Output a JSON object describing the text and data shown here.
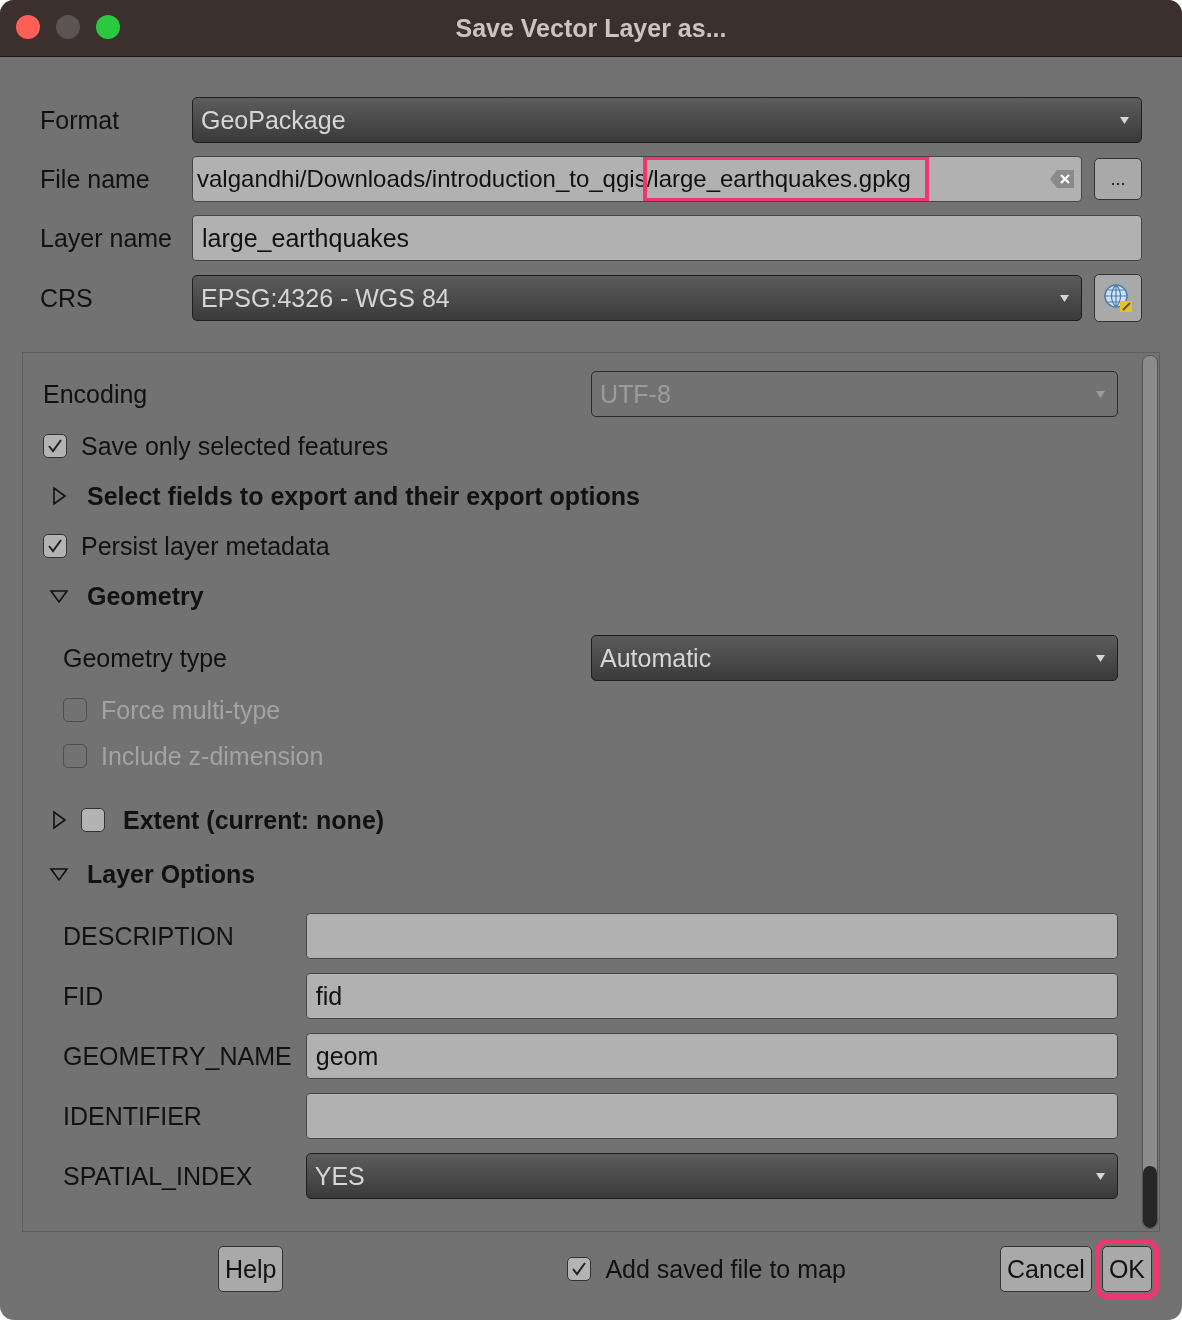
{
  "window": {
    "title": "Save Vector Layer as..."
  },
  "top_fields": [
    {
      "kind": "combo",
      "label": "Format",
      "value": "GeoPackage"
    },
    {
      "kind": "file",
      "label": "File name",
      "value": "valgandhi/Downloads/introduction_to_qgis",
      "value_highlighted": "/large_earthquakes.gpkg",
      "browse": "..."
    },
    {
      "kind": "text",
      "label": "Layer name",
      "value": "large_earthquakes"
    },
    {
      "kind": "crs",
      "label": "CRS",
      "value": "EPSG:4326 - WGS 84"
    }
  ],
  "options": [
    {
      "kind": "combo",
      "label": "Encoding",
      "value": "UTF-8",
      "disabled": true
    },
    {
      "kind": "checkbox",
      "label": "Save only selected features",
      "checked": true,
      "disabled": false
    },
    {
      "kind": "group",
      "label": "Select fields to export and their export options",
      "expanded": false
    },
    {
      "kind": "checkbox",
      "label": "Persist layer metadata",
      "checked": true,
      "disabled": false
    },
    {
      "kind": "group",
      "label": "Geometry",
      "expanded": true,
      "children": [
        {
          "kind": "combo",
          "label": "Geometry type",
          "value": "Automatic",
          "disabled": false
        },
        {
          "kind": "checkbox",
          "label": "Force multi-type",
          "checked": false,
          "disabled": true
        },
        {
          "kind": "checkbox",
          "label": "Include z-dimension",
          "checked": false,
          "disabled": true
        }
      ]
    },
    {
      "kind": "group",
      "label": "Extent (current: none)",
      "expanded": false,
      "checked": false
    },
    {
      "kind": "group",
      "label": "Layer Options",
      "expanded": true,
      "children": [
        {
          "kind": "text",
          "label": "DESCRIPTION"
        },
        {
          "kind": "text",
          "label": "FID",
          "value": "fid"
        },
        {
          "kind": "text",
          "label": "GEOMETRY_NAME",
          "value": "geom"
        },
        {
          "kind": "text",
          "label": "IDENTIFIER"
        },
        {
          "kind": "combo",
          "label": "SPATIAL_INDEX",
          "value": "YES",
          "disabled": false
        }
      ]
    }
  ],
  "footer": {
    "help": "Help",
    "add_to_map": {
      "label": "Add saved file to map",
      "checked": true
    },
    "cancel": "Cancel",
    "ok": {
      "label": "OK",
      "highlighted": true
    }
  }
}
